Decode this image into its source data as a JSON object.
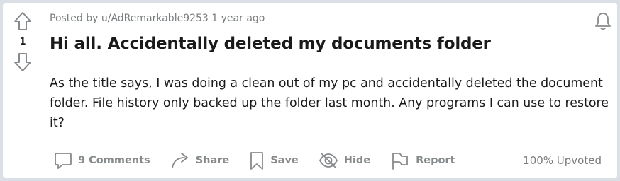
{
  "post": {
    "meta_prefix": "Posted by ",
    "author": "u/AdRemarkable9253",
    "time": "1 year ago",
    "vote_count": "1",
    "title": "Hi all. Accidentally deleted my documents folder",
    "body": "As the title says, I was doing a clean out of my pc and accidentally deleted the document folder. File history only backed up the folder last month. Any programs I can use to restore it?",
    "upvoted": "100% Upvoted"
  },
  "actions": {
    "comments_label": "9 Comments",
    "share_label": "Share",
    "save_label": "Save",
    "hide_label": "Hide",
    "report_label": "Report"
  },
  "icons": {
    "upvote": "arrow-up-icon",
    "downvote": "arrow-down-icon",
    "bell": "bell-icon",
    "comments": "comment-bubble-icon",
    "share": "share-arrow-icon",
    "save": "bookmark-icon",
    "hide": "eye-slash-icon",
    "report": "flag-icon"
  },
  "colors": {
    "background": "#dae0e6",
    "card": "#ffffff",
    "text": "#1a1a1b",
    "muted": "#878a8c"
  }
}
